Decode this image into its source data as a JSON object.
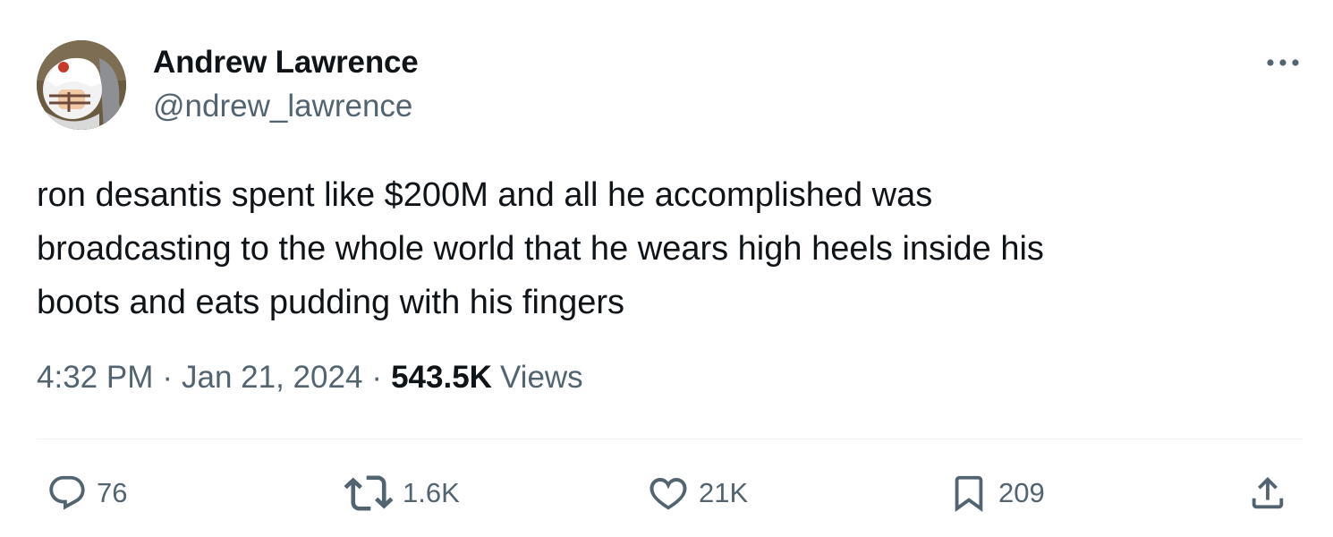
{
  "author": {
    "display_name": "Andrew Lawrence",
    "handle": "@ndrew_lawrence",
    "avatar_icon": "profile-avatar"
  },
  "more_icon": "more-horizontal-icon",
  "tweet": {
    "lines": [
      "ron desantis spent like $200M and all he accomplished was",
      "broadcasting to the whole world that he wears high heels inside his",
      "boots and eats pudding with his fingers"
    ]
  },
  "meta": {
    "time": "4:32 PM",
    "separator": "·",
    "date": "Jan 21, 2024",
    "views_count": "543.5K",
    "views_label": "Views"
  },
  "actions": {
    "reply": {
      "icon": "reply-icon",
      "count": "76"
    },
    "retweet": {
      "icon": "retweet-icon",
      "count": "1.6K"
    },
    "like": {
      "icon": "heart-icon",
      "count": "21K"
    },
    "bookmark": {
      "icon": "bookmark-icon",
      "count": "209"
    },
    "share": {
      "icon": "share-icon"
    }
  },
  "colors": {
    "text_primary": "#0f1419",
    "text_secondary": "#536471",
    "divider": "#eff3f4"
  }
}
